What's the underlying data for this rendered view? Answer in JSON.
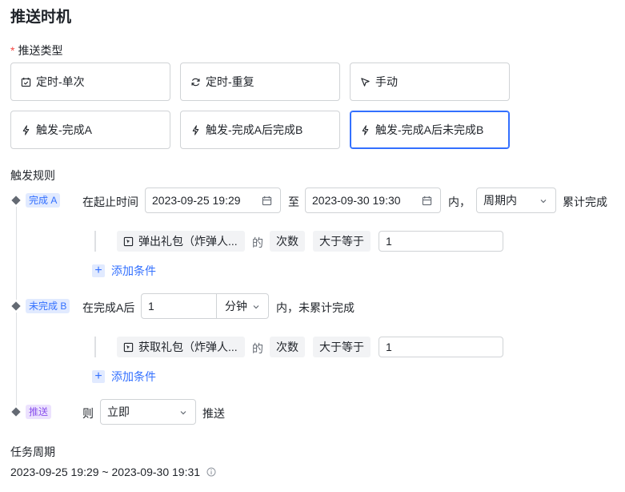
{
  "page_title": "推送时机",
  "push_type": {
    "label": "推送类型",
    "required_mark": "*",
    "options": [
      {
        "label": "定时-单次",
        "icon": "calendar-check-icon"
      },
      {
        "label": "定时-重复",
        "icon": "refresh-icon"
      },
      {
        "label": "手动",
        "icon": "cursor-icon"
      },
      {
        "label": "触发-完成A",
        "icon": "lightning-icon"
      },
      {
        "label": "触发-完成A后完成B",
        "icon": "lightning-icon"
      },
      {
        "label": "触发-完成A后未完成B",
        "icon": "lightning-icon",
        "selected": true
      }
    ]
  },
  "trigger_rules": {
    "label": "触发规则",
    "rule_a": {
      "tag": "完成 A",
      "prefix": "在起止时间",
      "start": "2023-09-25 19:29",
      "sep": "至",
      "end": "2023-09-30 19:30",
      "within": "内，",
      "period": "周期内",
      "suffix": "累计完成",
      "condition": {
        "event": "弹出礼包（炸弹人...",
        "of": "的",
        "metric": "次数",
        "op": "大于等于",
        "value": "1"
      },
      "add_condition": "添加条件"
    },
    "rule_b": {
      "tag": "未完成 B",
      "prefix": "在完成A后",
      "amount": "1",
      "unit": "分钟",
      "suffix": "内，未累计完成",
      "condition": {
        "event": "获取礼包（炸弹人...",
        "of": "的",
        "metric": "次数",
        "op": "大于等于",
        "value": "1"
      },
      "add_condition": "添加条件"
    },
    "push": {
      "tag": "推送",
      "prefix": "则",
      "timing": "立即",
      "suffix": "推送"
    }
  },
  "task_period": {
    "label": "任务周期",
    "value": "2023-09-25 19:29 ~ 2023-09-30 19:31"
  },
  "colors": {
    "accent": "#3370ff",
    "required": "#f54a45",
    "purple": "#8d55ed"
  }
}
